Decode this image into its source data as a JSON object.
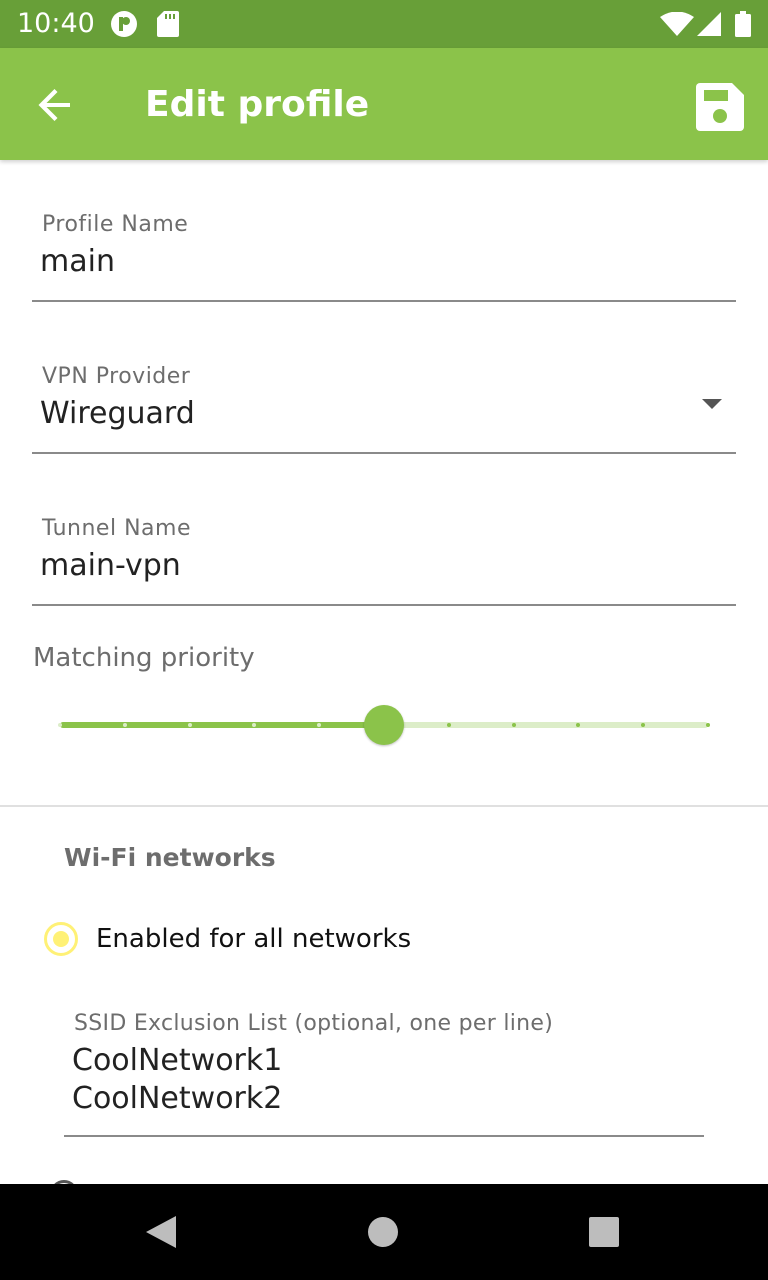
{
  "status_bar": {
    "time": "10:40",
    "icons": [
      "app-notification-icon",
      "sd-card-icon",
      "wifi-icon",
      "cell-signal-icon",
      "battery-icon"
    ]
  },
  "app_bar": {
    "title": "Edit profile",
    "back_icon": "arrow-back-icon",
    "save_icon": "save-icon",
    "color": "#8bc34a",
    "status_color": "#689f38"
  },
  "form": {
    "profile_name": {
      "label": "Profile Name",
      "value": "main"
    },
    "vpn_provider": {
      "label": "VPN Provider",
      "value": "Wireguard"
    },
    "tunnel_name": {
      "label": "Tunnel Name",
      "value": "main-vpn"
    },
    "matching_priority": {
      "label": "Matching priority",
      "step": 5,
      "steps_total": 10
    }
  },
  "wifi": {
    "section_title": "Wi-Fi networks",
    "radio_label": "Enabled for all networks",
    "radio_selected": true,
    "ssid_exclusion": {
      "label": "SSID Exclusion List (optional, one per line)",
      "lines": [
        "CoolNetwork1",
        "CoolNetwork2"
      ]
    }
  },
  "nav_bar": {
    "icons": [
      "nav-back-icon",
      "nav-home-icon",
      "nav-recents-icon"
    ]
  }
}
